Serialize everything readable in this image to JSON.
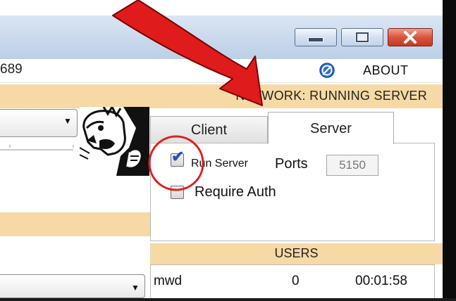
{
  "window": {
    "menu_left_text": "689",
    "about_label": "ABOUT",
    "controls": [
      "minimize",
      "maximize",
      "close"
    ]
  },
  "network_panel": {
    "header": "NETWORK: RUNNING SERVER",
    "tabs": [
      {
        "label": "Client",
        "selected": false
      },
      {
        "label": "Server",
        "selected": true
      }
    ],
    "run_server": {
      "label": "Run Server",
      "checked": true
    },
    "ports_label": "Ports",
    "ports_value": "5150",
    "require_auth": {
      "label": "Require Auth",
      "checked": false
    }
  },
  "users_panel": {
    "header": "USERS",
    "rows": [
      {
        "name": "mwd",
        "count": "0",
        "time": "00:01:58"
      }
    ]
  },
  "annotation": {
    "arrow_color": "#e01b1b",
    "circle_color": "#e02020"
  },
  "icons": [
    "about-icon",
    "avatar-icon",
    "dropdown-arrow-icon"
  ]
}
